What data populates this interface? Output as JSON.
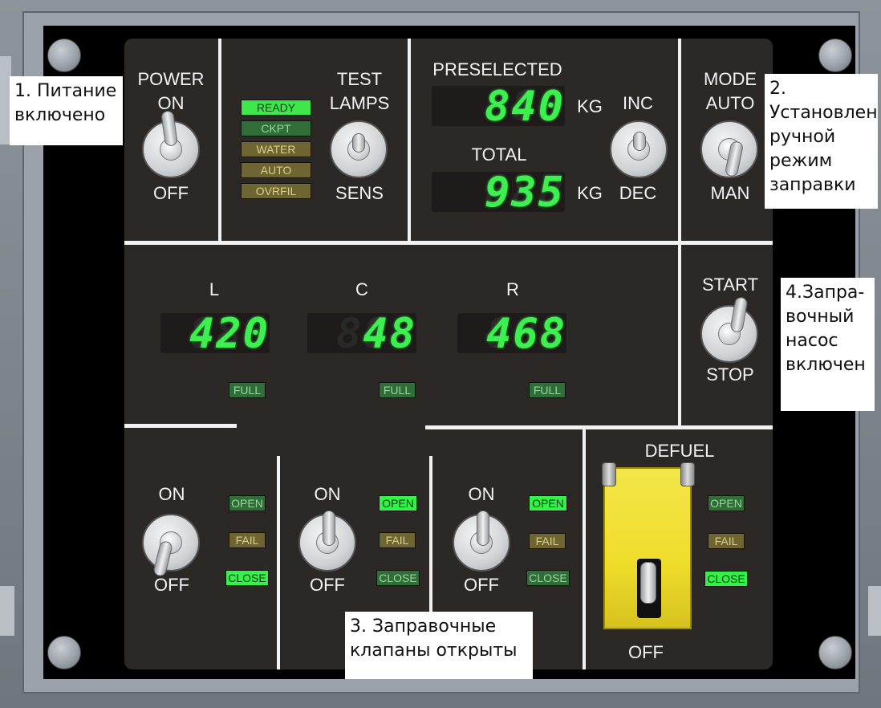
{
  "panel": {
    "power_label": "POWER",
    "power_on": "ON",
    "power_off": "OFF",
    "test_label_1": "TEST",
    "test_label_2": "LAMPS",
    "test_sens": "SENS",
    "lamps": {
      "ready": "READY",
      "ckpt": "CKPT",
      "water": "WATER",
      "auto": "AUTO",
      "ovrfil": "OVRFIL"
    },
    "preselected_label": "PRESELECTED",
    "preselected_value": "840",
    "total_label": "TOTAL",
    "total_value": "935",
    "kg_unit": "KG",
    "inc_label": "INC",
    "dec_label": "DEC",
    "mode_label": "MODE",
    "mode_auto": "AUTO",
    "mode_man": "MAN",
    "tanks": [
      {
        "label": "L",
        "value": "420",
        "full": "FULL"
      },
      {
        "label": "C",
        "value": "48",
        "full": "FULL"
      },
      {
        "label": "R",
        "value": "468",
        "full": "FULL"
      }
    ],
    "start_label": "START",
    "stop_label": "STOP",
    "valves": [
      {
        "on": "ON",
        "off": "OFF",
        "open": "OPEN",
        "fail": "FAIL",
        "close": "CLOSE"
      },
      {
        "on": "ON",
        "off": "OFF",
        "open": "OPEN",
        "fail": "FAIL",
        "close": "CLOSE"
      },
      {
        "on": "ON",
        "off": "OFF",
        "open": "OPEN",
        "fail": "FAIL",
        "close": "CLOSE"
      }
    ],
    "defuel": {
      "label": "DEFUEL",
      "off": "OFF",
      "open": "OPEN",
      "fail": "FAIL",
      "close": "CLOSE"
    },
    "ghost_digits": "888"
  },
  "notes": {
    "note1": "1. Питание включено",
    "note2": "2. Установлен ручной режим заправки",
    "note3": "3. Заправочные клапаны открыты",
    "note4": "4.Запра-вочный насос включен"
  },
  "colors": {
    "lamp_bright_green": "#35f24a",
    "lamp_dim_green": "#2f6e36",
    "lamp_dim_amber": "#6e6532",
    "segment_green": "#3cf04f",
    "guard_yellow": "#f0dc2a"
  }
}
